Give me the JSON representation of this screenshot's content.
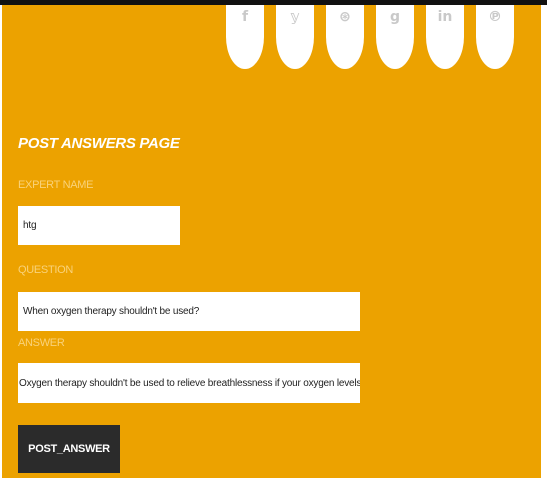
{
  "social": [
    {
      "name": "facebook",
      "glyph": "f"
    },
    {
      "name": "twitter",
      "glyph": "𝕪"
    },
    {
      "name": "dribbble",
      "glyph": "⊛"
    },
    {
      "name": "google-plus",
      "glyph": "g"
    },
    {
      "name": "linkedin",
      "glyph": "in"
    },
    {
      "name": "pinterest",
      "glyph": "℗"
    }
  ],
  "page_title": "POST ANSWERS PAGE",
  "form": {
    "expert_label": "EXPERT NAME",
    "expert_value": "htg",
    "question_label": "QUESTION",
    "question_value": "When oxygen therapy shouldn't be used?",
    "answer_label": "ANSWER",
    "answer_value": "Oxygen therapy shouldn't be used to relieve breathlessness if your oxygen levels are norm",
    "submit_label": "POST_ANSWER"
  },
  "colors": {
    "panel": "#eca200",
    "button": "#2b2b2b",
    "label": "#f9d27a"
  }
}
